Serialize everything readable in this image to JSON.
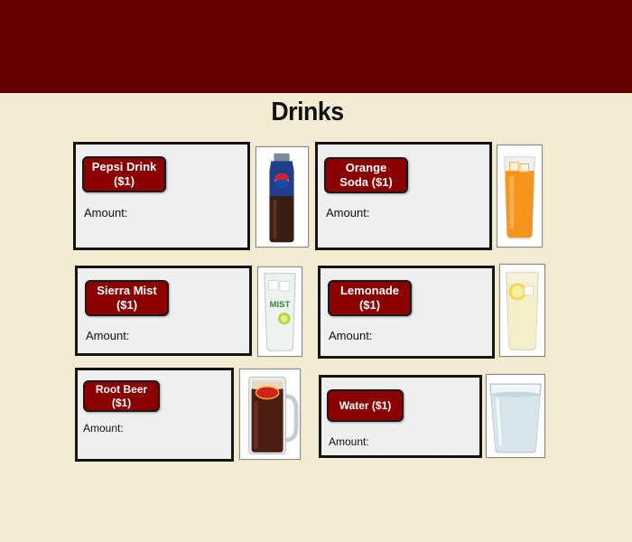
{
  "page": {
    "title": "Drinks"
  },
  "colors": {
    "header": "#640000",
    "background": "#f3ebd2",
    "button": "#8a0000"
  },
  "drinks": [
    {
      "id": "pepsi",
      "name_line1": "Pepsi Drink",
      "name_line2": "($1)",
      "amount_label": "Amount:",
      "image": "pepsi-bottle-icon"
    },
    {
      "id": "orange-soda",
      "name_line1": "Orange",
      "name_line2": "Soda ($1)",
      "amount_label": "Amount:",
      "image": "orange-soda-glass-icon"
    },
    {
      "id": "sierra-mist",
      "name_line1": "Sierra Mist",
      "name_line2": "($1)",
      "amount_label": "Amount:",
      "image": "sierra-mist-glass-icon"
    },
    {
      "id": "lemonade",
      "name_line1": "Lemonade",
      "name_line2": "($1)",
      "amount_label": "Amount:",
      "image": "lemonade-glass-icon"
    },
    {
      "id": "root-beer",
      "name_line1": "Root Beer",
      "name_line2": "($1)",
      "amount_label": "Amount:",
      "image": "root-beer-mug-icon"
    },
    {
      "id": "water",
      "name_line1": "Water ($1)",
      "name_line2": "",
      "amount_label": "Amount:",
      "image": "water-glass-icon"
    }
  ]
}
